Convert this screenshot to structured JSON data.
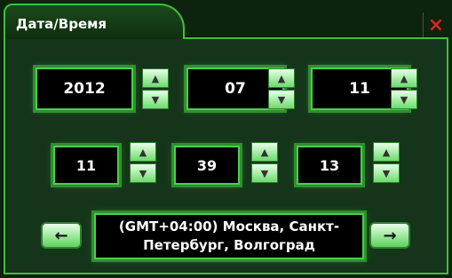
{
  "window": {
    "title": "Дата/Время",
    "close_icon": "×"
  },
  "date": {
    "year": "2012",
    "month": "07",
    "day": "11"
  },
  "time": {
    "hour": "11",
    "minute": "39",
    "second": "13"
  },
  "spinner": {
    "up_icon": "▲",
    "down_icon": "▼"
  },
  "timezone": {
    "value": "(GMT+04:00) Москва, Санкт-Петербург, Волгоград",
    "prev_icon": "←",
    "next_icon": "→"
  },
  "colors": {
    "accent": "#3fbf3f",
    "background": "#0d230d",
    "close": "#e02020"
  }
}
